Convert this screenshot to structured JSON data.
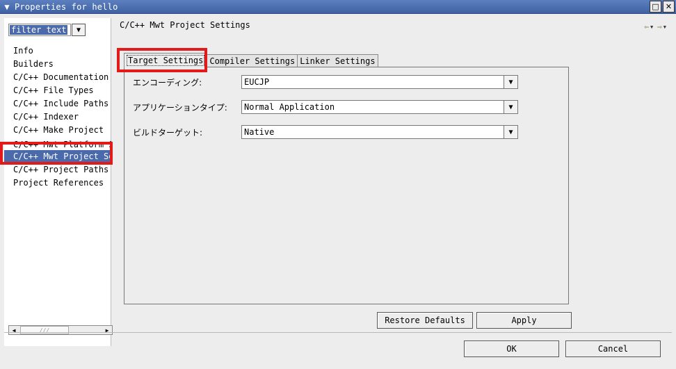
{
  "window": {
    "title": "Properties for hello",
    "menu_glyph": "▼",
    "restore_glyph": "□",
    "close_glyph": "✕"
  },
  "filter": {
    "text": "filter text",
    "drop_glyph": "▼"
  },
  "nav": {
    "items": [
      {
        "label": "Info"
      },
      {
        "label": "Builders"
      },
      {
        "label": "C/C++ Documentation"
      },
      {
        "label": "C/C++ File Types"
      },
      {
        "label": "C/C++ Include Paths"
      },
      {
        "label": "C/C++ Indexer"
      },
      {
        "label": "C/C++ Make Project"
      },
      {
        "label": "C/C++ Mwt Platform S"
      },
      {
        "label": "C/C++ Mwt Project Se"
      },
      {
        "label": "C/C++ Project Paths"
      },
      {
        "label": "Project References"
      }
    ],
    "selected_index": 8
  },
  "scroll": {
    "left_glyph": "◀",
    "right_glyph": "▶",
    "grip": "///"
  },
  "page": {
    "title": "C/C++ Mwt Project Settings",
    "back_glyph": "⇦",
    "forward_glyph": "⇨",
    "dd_glyph": "▼"
  },
  "tabs": [
    {
      "label": "Target Settings",
      "active": true
    },
    {
      "label": "Compiler Settings",
      "active": false
    },
    {
      "label": "Linker Settings",
      "active": false
    }
  ],
  "form": {
    "encoding_label": "エンコーディング:",
    "encoding_value": "EUCJP",
    "app_type_label": "アプリケーションタイプ:",
    "app_type_value": "Normal Application",
    "build_target_label": "ビルドターゲット:",
    "build_target_value": "Native",
    "combo_glyph": "▼"
  },
  "buttons": {
    "restore_defaults": "Restore Defaults",
    "apply": "Apply",
    "ok": "OK",
    "cancel": "Cancel"
  },
  "colors": {
    "highlight": "#e21a1a",
    "selection": "#4a6aab",
    "titlebar": "#4f72b3"
  }
}
